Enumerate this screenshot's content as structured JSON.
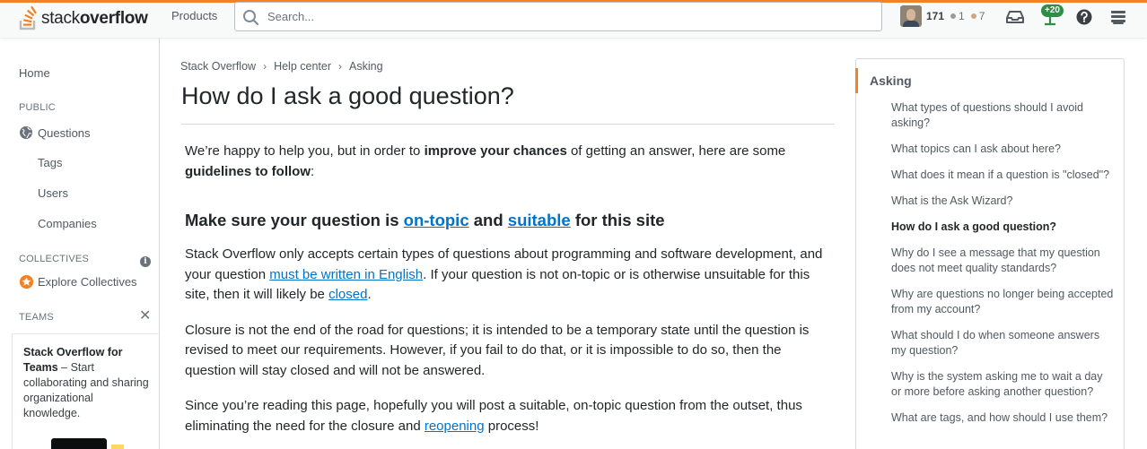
{
  "header": {
    "logo_word1": "stack",
    "logo_word2": "overflow",
    "products_label": "Products",
    "search_placeholder": "Search...",
    "reputation": "171",
    "silver_badges": "1",
    "bronze_badges": "7",
    "achievements_badge": "+20"
  },
  "sidebar": {
    "home": "Home",
    "public_heading": "PUBLIC",
    "questions": "Questions",
    "tags": "Tags",
    "users": "Users",
    "companies": "Companies",
    "collectives_heading": "COLLECTIVES",
    "explore_collectives": "Explore Collectives",
    "teams_heading": "TEAMS",
    "teams_title": "Stack Overflow for Teams",
    "teams_text": "– Start collaborating and sharing organizational knowledge."
  },
  "breadcrumb": {
    "items": [
      "Stack Overflow",
      "Help center",
      "Asking"
    ]
  },
  "page": {
    "title": "How do I ask a good question?",
    "intro_1": "We’re happy to help you, but in order to ",
    "intro_bold_1": "improve your chances",
    "intro_2": " of getting an answer, here are some ",
    "intro_bold_2": "guidelines to follow",
    "intro_3": ":",
    "h2_1": "Make sure your question is ",
    "h2_link_1": "on-topic",
    "h2_2": " and ",
    "h2_link_2": "suitable",
    "h2_3": " for this site",
    "p1_1": "Stack Overflow only accepts certain types of questions about programming and software development, and your question ",
    "p1_link_1": "must be written in English",
    "p1_2": ". If your question is not on-topic or is otherwise unsuitable for this site, then it will likely be ",
    "p1_link_2": "closed",
    "p1_3": ".",
    "p2": "Closure is not the end of the road for questions; it is intended to be a temporary state until the question is revised to meet our requirements. However, if you fail to do that, or it is impossible to do so, then the question will stay closed and will not be answered.",
    "p3_1": "Since you’re reading this page, hopefully you will post a suitable, on-topic question from the outset, thus eliminating the need for the closure and ",
    "p3_link": "reopening",
    "p3_2": " process!"
  },
  "right_panel": {
    "heading": "Asking",
    "items": [
      "What types of questions should I avoid asking?",
      "What topics can I ask about here?",
      "What does it mean if a question is \"closed\"?",
      "What is the Ask Wizard?",
      "How do I ask a good question?",
      "Why do I see a message that my question does not meet quality standards?",
      "Why are questions no longer being accepted from my account?",
      "What should I do when someone answers my question?",
      "Why is the system asking me to wait a day or more before asking another question?",
      "What are tags, and how should I use them?"
    ],
    "active_index": 4
  },
  "colors": {
    "accent": "#f48225",
    "link": "#0074cc",
    "silver": "#9a9c9f",
    "bronze": "#d1a684",
    "achievement": "#2f8d46"
  }
}
